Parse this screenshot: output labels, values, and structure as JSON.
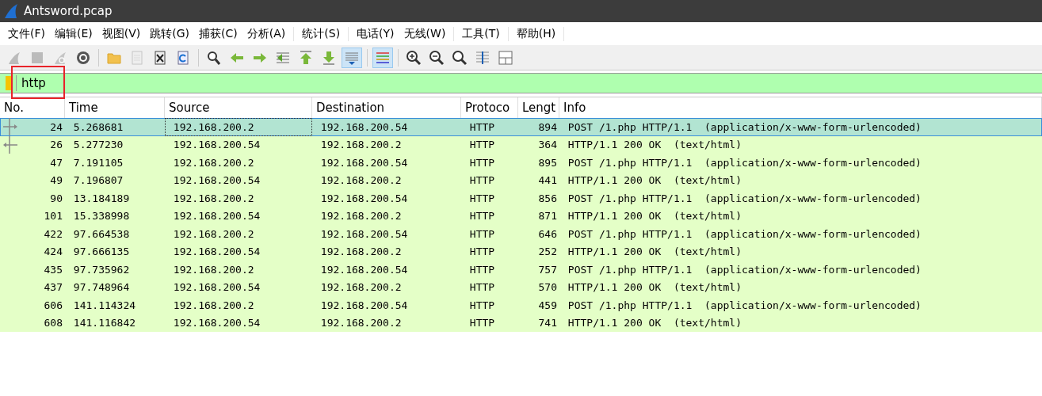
{
  "window": {
    "title": "Antsword.pcap"
  },
  "menu": [
    "文件(F)",
    "编辑(E)",
    "视图(V)",
    "跳转(G)",
    "捕获(C)",
    "分析(A)",
    "统计(S)",
    "电话(Y)",
    "无线(W)",
    "工具(T)",
    "帮助(H)"
  ],
  "toolbar": [
    {
      "kind": "start",
      "disabled": true,
      "pressed": false
    },
    {
      "kind": "stop",
      "disabled": true,
      "pressed": false
    },
    {
      "kind": "restart",
      "disabled": true,
      "pressed": false
    },
    {
      "kind": "options",
      "disabled": false,
      "pressed": false
    },
    {
      "kind": "separator"
    },
    {
      "kind": "open",
      "disabled": false,
      "pressed": false
    },
    {
      "kind": "save",
      "disabled": true,
      "pressed": false
    },
    {
      "kind": "close",
      "disabled": false,
      "pressed": false
    },
    {
      "kind": "reload",
      "disabled": false,
      "pressed": false
    },
    {
      "kind": "separator"
    },
    {
      "kind": "find",
      "disabled": false,
      "pressed": false
    },
    {
      "kind": "back",
      "disabled": false,
      "pressed": false
    },
    {
      "kind": "forward",
      "disabled": false,
      "pressed": false
    },
    {
      "kind": "goto",
      "disabled": false,
      "pressed": false
    },
    {
      "kind": "first",
      "disabled": false,
      "pressed": false
    },
    {
      "kind": "last",
      "disabled": false,
      "pressed": false
    },
    {
      "kind": "autoscroll",
      "disabled": false,
      "pressed": true
    },
    {
      "kind": "separator"
    },
    {
      "kind": "colorize",
      "disabled": false,
      "pressed": true
    },
    {
      "kind": "separator"
    },
    {
      "kind": "zoom-in",
      "disabled": false,
      "pressed": false
    },
    {
      "kind": "zoom-out",
      "disabled": false,
      "pressed": false
    },
    {
      "kind": "zoom-normal",
      "disabled": false,
      "pressed": false
    },
    {
      "kind": "resize",
      "disabled": false,
      "pressed": false
    },
    {
      "kind": "layout",
      "disabled": false,
      "pressed": false
    }
  ],
  "filter": {
    "value": "http",
    "annotated": true
  },
  "table": {
    "columns": [
      "No.",
      "Time",
      "Source",
      "Destination",
      "Protoco",
      "Lengt",
      "Info"
    ],
    "rows": [
      {
        "cells": [
          "24",
          "5.268681",
          "192.168.200.2",
          "192.168.200.54",
          "HTTP",
          "894",
          "POST /1.php HTTP/1.1  (application/x-www-form-urlencoded)"
        ],
        "selected": true,
        "request_arrow": true,
        "response_arrow": false
      },
      {
        "cells": [
          "26",
          "5.277230",
          "192.168.200.54",
          "192.168.200.2",
          "HTTP",
          "364",
          "HTTP/1.1 200 OK  (text/html)"
        ],
        "selected": false,
        "request_arrow": false,
        "response_arrow": true
      },
      {
        "cells": [
          "47",
          "7.191105",
          "192.168.200.2",
          "192.168.200.54",
          "HTTP",
          "895",
          "POST /1.php HTTP/1.1  (application/x-www-form-urlencoded)"
        ],
        "selected": false
      },
      {
        "cells": [
          "49",
          "7.196807",
          "192.168.200.54",
          "192.168.200.2",
          "HTTP",
          "441",
          "HTTP/1.1 200 OK  (text/html)"
        ],
        "selected": false
      },
      {
        "cells": [
          "90",
          "13.184189",
          "192.168.200.2",
          "192.168.200.54",
          "HTTP",
          "856",
          "POST /1.php HTTP/1.1  (application/x-www-form-urlencoded)"
        ],
        "selected": false
      },
      {
        "cells": [
          "101",
          "15.338998",
          "192.168.200.54",
          "192.168.200.2",
          "HTTP",
          "871",
          "HTTP/1.1 200 OK  (text/html)"
        ],
        "selected": false
      },
      {
        "cells": [
          "422",
          "97.664538",
          "192.168.200.2",
          "192.168.200.54",
          "HTTP",
          "646",
          "POST /1.php HTTP/1.1  (application/x-www-form-urlencoded)"
        ],
        "selected": false
      },
      {
        "cells": [
          "424",
          "97.666135",
          "192.168.200.54",
          "192.168.200.2",
          "HTTP",
          "252",
          "HTTP/1.1 200 OK  (text/html)"
        ],
        "selected": false
      },
      {
        "cells": [
          "435",
          "97.735962",
          "192.168.200.2",
          "192.168.200.54",
          "HTTP",
          "757",
          "POST /1.php HTTP/1.1  (application/x-www-form-urlencoded)"
        ],
        "selected": false
      },
      {
        "cells": [
          "437",
          "97.748964",
          "192.168.200.54",
          "192.168.200.2",
          "HTTP",
          "570",
          "HTTP/1.1 200 OK  (text/html)"
        ],
        "selected": false
      },
      {
        "cells": [
          "606",
          "141.114324",
          "192.168.200.2",
          "192.168.200.54",
          "HTTP",
          "459",
          "POST /1.php HTTP/1.1  (application/x-www-form-urlencoded)"
        ],
        "selected": false
      },
      {
        "cells": [
          "608",
          "141.116842",
          "192.168.200.54",
          "192.168.200.2",
          "HTTP",
          "741",
          "HTTP/1.1 200 OK  (text/html)"
        ],
        "selected": false
      }
    ]
  }
}
